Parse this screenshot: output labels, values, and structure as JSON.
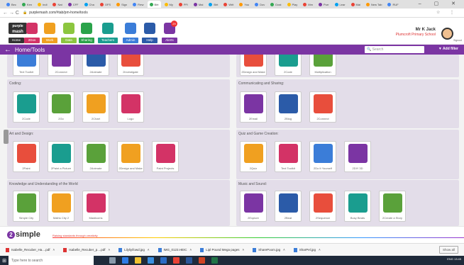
{
  "browser": {
    "tabs": [
      "Bec",
      "Ken",
      "Indi",
      "Nat",
      "CFF",
      "Cha",
      "OFS",
      "Sign",
      "Fiew",
      "Birt",
      "My",
      "PFi",
      "Mai",
      "Birt",
      "Writ",
      "You",
      "Dov",
      "Dost",
      "Play",
      "Mm",
      "Purr",
      "Lear",
      "Mai",
      "New Tab",
      "RUF"
    ],
    "active_tab": "Birt",
    "url": "purplemash.com/#tab/pm-home/tools"
  },
  "header": {
    "logo_line1": "purple",
    "logo_line2": "mash",
    "nav": [
      {
        "label": "Home",
        "icon": "home-icon",
        "color": "#333333"
      },
      {
        "label": "2Dos",
        "icon": "checklist-icon",
        "color": "#d33366"
      },
      {
        "label": "Work",
        "icon": "folder-icon",
        "color": "#f0a020"
      },
      {
        "label": "Data",
        "icon": "chart-icon",
        "color": "#8cc63f"
      },
      {
        "label": "Sharing",
        "icon": "sharing-icon",
        "color": "#2aa34a"
      },
      {
        "label": "Teachers",
        "icon": "graduation-cap-icon",
        "color": "#1a9d8f"
      },
      {
        "label": "Admin",
        "icon": "gear-icon",
        "color": "#3b7dd8"
      },
      {
        "label": "Help",
        "icon": "help-icon",
        "color": "#2b5ba8"
      },
      {
        "label": "Alerts",
        "icon": "bell-icon",
        "color": "#7b35a3"
      }
    ],
    "alerts_badge": "29",
    "user_name": "Mr K Jack",
    "school": "Plumcroft Primary School",
    "signout": "Signout"
  },
  "toolbar": {
    "back_label": "←",
    "title": "Home/Tools",
    "search_placeholder": "Search",
    "filter_label": "Add filter"
  },
  "sections": {
    "top_left": [
      "Text Toolkit",
      "2Connect",
      "2Animate",
      "2Investigate"
    ],
    "top_right": [
      "2Design and Make",
      "2Code",
      "Multiplication"
    ],
    "coding": {
      "title": "Coding:",
      "tools": [
        "2Code",
        "2Go",
        "2Chart",
        "Logo"
      ]
    },
    "communicating": {
      "title": "Communicating and Sharing:",
      "tools": [
        "2Email",
        "2Blog",
        "2Connect"
      ]
    },
    "art": {
      "title": "Art and Design:",
      "tools": [
        "2Paint",
        "2Paint a Picture",
        "2Animate",
        "2Design and Make",
        "Paint Projects"
      ]
    },
    "quiz": {
      "title": "Quiz and Game Creation:",
      "tools": [
        "2Quiz",
        "Text Toolkit",
        "2Do It Yourself",
        "2DIY 3D"
      ]
    },
    "knowledge": {
      "title": "Knowledge and Understanding of the World",
      "tools": [
        "Simple City",
        "Maths City 2",
        "Masticoms"
      ]
    },
    "music": {
      "title": "Music and Sound:",
      "tools": [
        "2Explore",
        "2Beat",
        "2Sequence",
        "Busy Beats",
        "2Create a Story"
      ]
    }
  },
  "footer": {
    "brand": "simple",
    "tagline": "Raising standards through creativity"
  },
  "downloads": {
    "items": [
      "Isabelle_Recuber_Ha....pdf",
      "Isabelle_Recuber_p....pdf",
      "Lilyliy/lowd.jpg",
      "IMG_0123.HEIC",
      "Lipl Pound Mega pages",
      "SharePoom.jpg",
      "SharPel.jpg"
    ],
    "show_all": "Show all"
  },
  "taskbar": {
    "search_placeholder": "Type here to search",
    "tray": "ENG 13:45"
  }
}
